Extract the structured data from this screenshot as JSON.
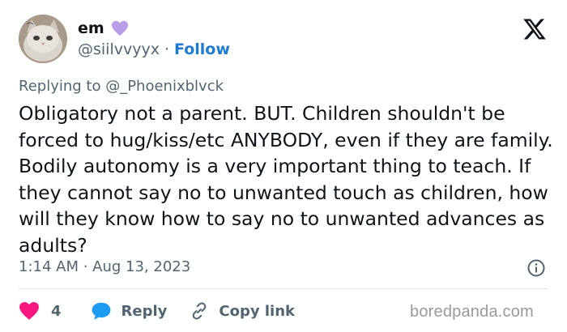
{
  "author": {
    "name": "em",
    "handle": "@siilvvyyx",
    "separator": "·",
    "follow_label": "Follow",
    "badge_icon": "purple-heart-icon",
    "avatar": "cat-avatar-image"
  },
  "platform_logo": "x-logo-icon",
  "replying_to": "Replying to @_Phoenixblvck",
  "tweet_text": "Obligatory not a parent. BUT. Children shouldn't be forced to hug/kiss/etc ANYBODY, even if they are family. Bodily autonomy is a very important thing to teach. If they cannot say no to unwanted touch as children, how will they know how to say no to unwanted advances as adults?",
  "timestamp": "1:14 AM · Aug 13, 2023",
  "actions": {
    "like_count": "4",
    "reply_label": "Reply",
    "copy_link_label": "Copy link"
  },
  "watermark": "boredpanda.com",
  "colors": {
    "like": "#f91880",
    "reply": "#1d9bf0",
    "follow": "#1d7bd1",
    "heart_emoji": "#b79ee6"
  }
}
